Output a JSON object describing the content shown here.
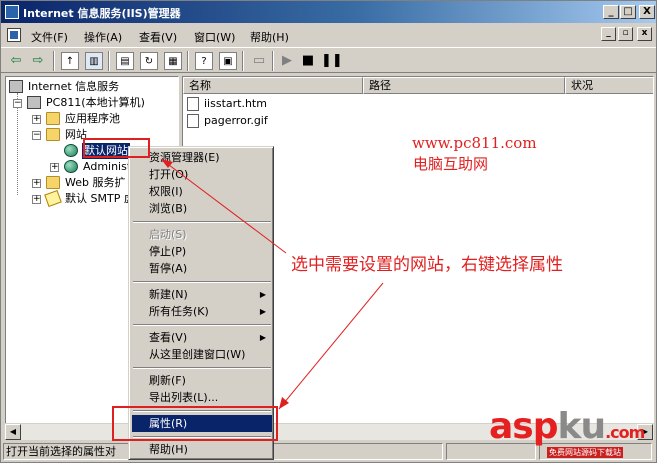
{
  "window": {
    "title": "Internet 信息服务(IIS)管理器",
    "controls": {
      "minimize": "_",
      "maximize": "□",
      "close": "X"
    }
  },
  "menubar": {
    "items": [
      "文件(F)",
      "操作(A)",
      "查看(V)",
      "窗口(W)",
      "帮助(H)"
    ]
  },
  "tree": {
    "root": "Internet 信息服务",
    "computer": "PC811(本地计算机)",
    "app_pools": "应用程序池",
    "websites": "网站",
    "default_site": "默认网站",
    "admin_site": "Administ",
    "web_ext": "Web 服务扩",
    "smtp": "默认 SMTP 虚"
  },
  "list": {
    "columns": [
      "名称",
      "路径",
      "状况"
    ],
    "files": [
      "iisstart.htm",
      "pagerror.gif"
    ]
  },
  "context_menu": {
    "items": [
      {
        "label": "资源管理器(E)",
        "disabled": false
      },
      {
        "label": "打开(O)",
        "disabled": false
      },
      {
        "label": "权限(I)",
        "disabled": false
      },
      {
        "label": "浏览(B)",
        "disabled": false
      },
      {
        "label": "启动(S)",
        "disabled": true
      },
      {
        "label": "停止(P)",
        "disabled": false
      },
      {
        "label": "暂停(A)",
        "disabled": false
      },
      {
        "label": "新建(N)",
        "disabled": false,
        "submenu": true
      },
      {
        "label": "所有任务(K)",
        "disabled": false,
        "submenu": true
      },
      {
        "label": "查看(V)",
        "disabled": false,
        "submenu": true
      },
      {
        "label": "从这里创建窗口(W)",
        "disabled": false
      },
      {
        "label": "刷新(F)",
        "disabled": false
      },
      {
        "label": "导出列表(L)...",
        "disabled": false
      },
      {
        "label": "属性(R)",
        "disabled": false,
        "highlighted": true
      },
      {
        "label": "帮助(H)",
        "disabled": false
      }
    ]
  },
  "statusbar": {
    "text": "打开当前选择的属性对"
  },
  "annotations": {
    "url": "www.pc811.com",
    "site_name": "电脑互助网",
    "instruction": "选中需要设置的网站，右键选择属性"
  },
  "watermark": {
    "part1": "asp",
    "part2": "ku",
    "part3": ".com",
    "subtitle": "免费网站源码下载站"
  },
  "colors": {
    "titlebar": "#0a246a",
    "highlight": "#0a246a",
    "annotation": "#e02020",
    "chrome": "#d4d0c8"
  }
}
